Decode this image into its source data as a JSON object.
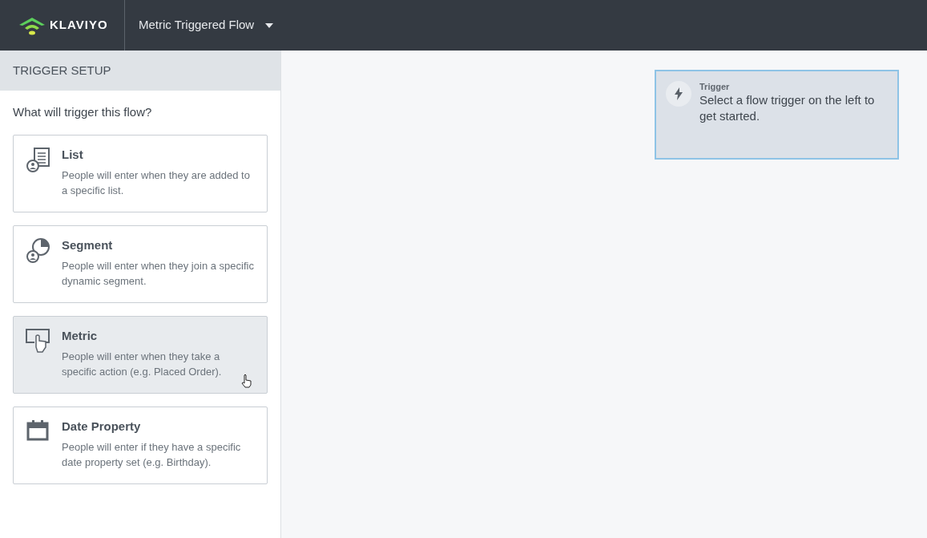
{
  "header": {
    "logo": "KLAVIYO",
    "flow_title": "Metric Triggered Flow"
  },
  "sidebar": {
    "title": "TRIGGER SETUP",
    "question": "What will trigger this flow?",
    "options": [
      {
        "kind": "list",
        "title": "List",
        "description": "People will enter when they are added to a specific list.",
        "hovered": false
      },
      {
        "kind": "segment",
        "title": "Segment",
        "description": "People will enter when they join a specific dynamic segment.",
        "hovered": false
      },
      {
        "kind": "metric",
        "title": "Metric",
        "description": "People will enter when they take a specific action (e.g. Placed Order).",
        "hovered": true
      },
      {
        "kind": "date",
        "title": "Date Property",
        "description": "People will enter if they have a specific date property set (e.g. Birthday).",
        "hovered": false
      }
    ]
  },
  "canvas": {
    "trigger_node": {
      "label": "Trigger",
      "text": "Select a flow trigger on the left to get started."
    }
  }
}
